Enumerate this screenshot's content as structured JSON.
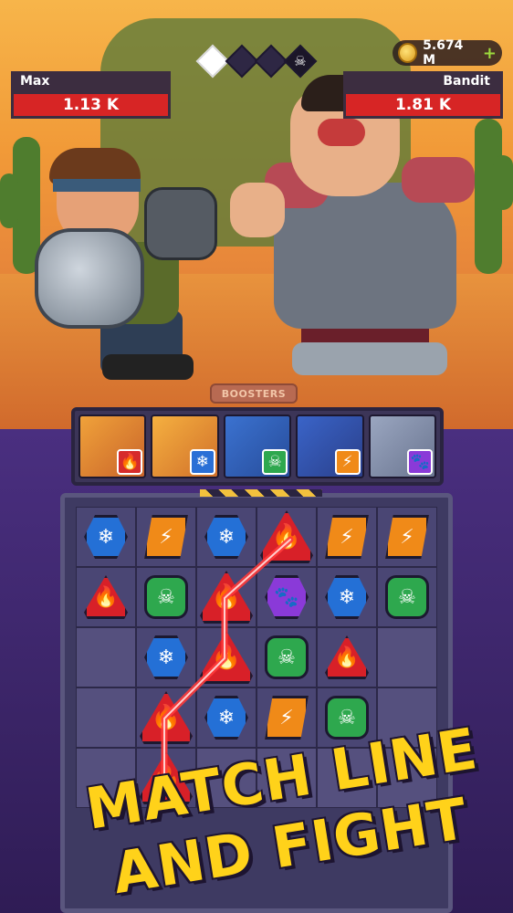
{
  "hud": {
    "currency": "5.674 M",
    "currency_plus": "+",
    "boss_icon": "☠"
  },
  "player": {
    "name": "Max",
    "hp": "1.13 K"
  },
  "enemy": {
    "name": "Bandit",
    "hp": "1.81 K"
  },
  "boosters_label": "BOOSTERS",
  "heroes": [
    {
      "icon": "bazooka-icon",
      "element": "fire",
      "element_glyph": "🔥",
      "color": "#d62b2b"
    },
    {
      "icon": "robot-helmet-icon",
      "element": "ice",
      "element_glyph": "❄",
      "color": "#2a6fd6"
    },
    {
      "icon": "beehive-icon",
      "element": "poison",
      "element_glyph": "☠",
      "color": "#2ea84e"
    },
    {
      "icon": "mech-suit-icon",
      "element": "lightning",
      "element_glyph": "⚡",
      "color": "#f08a18"
    },
    {
      "icon": "gorilla-icon",
      "element": "paw",
      "element_glyph": "🐾",
      "color": "#8a3ad8"
    }
  ],
  "board": [
    [
      "ice",
      "lightning",
      "ice",
      "fire*",
      "lightning",
      "lightning"
    ],
    [
      "fire",
      "poison",
      "fire*",
      "paw",
      "ice",
      "poison"
    ],
    [
      "",
      "ice",
      "fire*",
      "poison",
      "fire",
      ""
    ],
    [
      "",
      "fire*",
      "ice",
      "lightning",
      "poison",
      ""
    ],
    [
      "",
      "fire*",
      "",
      "",
      "",
      ""
    ]
  ],
  "glyphs": {
    "ice": "❄",
    "lightning": "⚡",
    "fire": "🔥",
    "poison": "☠",
    "paw": "🐾"
  },
  "promo": {
    "line1": "MATCH LINE",
    "line2": "AND FIGHT"
  }
}
